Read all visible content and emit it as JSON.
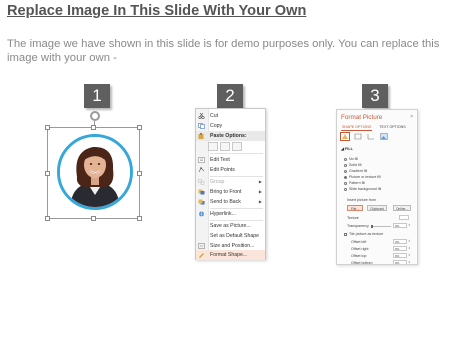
{
  "title": "Replace Image In This Slide With Your Own",
  "description": "The image we have shown in this slide is for demo purposes only. You can replace this image with your own -",
  "steps": [
    "1",
    "2",
    "3"
  ],
  "colors": {
    "title": "#555555",
    "description": "#8a8a8a",
    "step_badge": "#5f5f5f",
    "photo_ring": "#35a7db",
    "accent": "#c55a3a"
  },
  "context_menu": {
    "items": [
      {
        "label": "Cut",
        "icon": "scissors-icon"
      },
      {
        "label": "Copy",
        "icon": "copy-icon"
      },
      {
        "label": "Paste Options:",
        "icon": "paste-icon"
      },
      {
        "label": "Edit Text",
        "icon": "edit-text-icon"
      },
      {
        "label": "Edit Points",
        "icon": "edit-points-icon"
      },
      {
        "label": "Group",
        "icon": "group-icon"
      },
      {
        "label": "Bring to Front",
        "icon": "bring-front-icon"
      },
      {
        "label": "Send to Back",
        "icon": "send-back-icon"
      },
      {
        "label": "Hyperlink...",
        "icon": "hyperlink-icon"
      },
      {
        "label": "Save as Picture...",
        "icon": ""
      },
      {
        "label": "Set as Default Shape",
        "icon": ""
      },
      {
        "label": "Size and Position...",
        "icon": "size-position-icon"
      },
      {
        "label": "Format Shape...",
        "icon": "format-shape-icon"
      }
    ]
  },
  "format_pane": {
    "title": "Format Picture",
    "tabs": [
      "SHAPE OPTIONS",
      "TEXT OPTIONS"
    ],
    "section": "FILL",
    "fill_options": [
      "No fill",
      "Solid fill",
      "Gradient fill",
      "Picture or texture fill",
      "Pattern fill",
      "Slide background fill"
    ],
    "insert_from_label": "Insert picture from",
    "buttons": [
      "File...",
      "Clipboard",
      "Online..."
    ],
    "texture_label": "Texture",
    "transparency_label": "Transparency",
    "transparency_value": "0%",
    "tile_label": "Tile picture as texture",
    "offsets": [
      {
        "label": "Offset left",
        "value": "0%"
      },
      {
        "label": "Offset right",
        "value": "0%"
      },
      {
        "label": "Offset top",
        "value": "0%"
      },
      {
        "label": "Offset bottom",
        "value": "0%"
      }
    ]
  }
}
